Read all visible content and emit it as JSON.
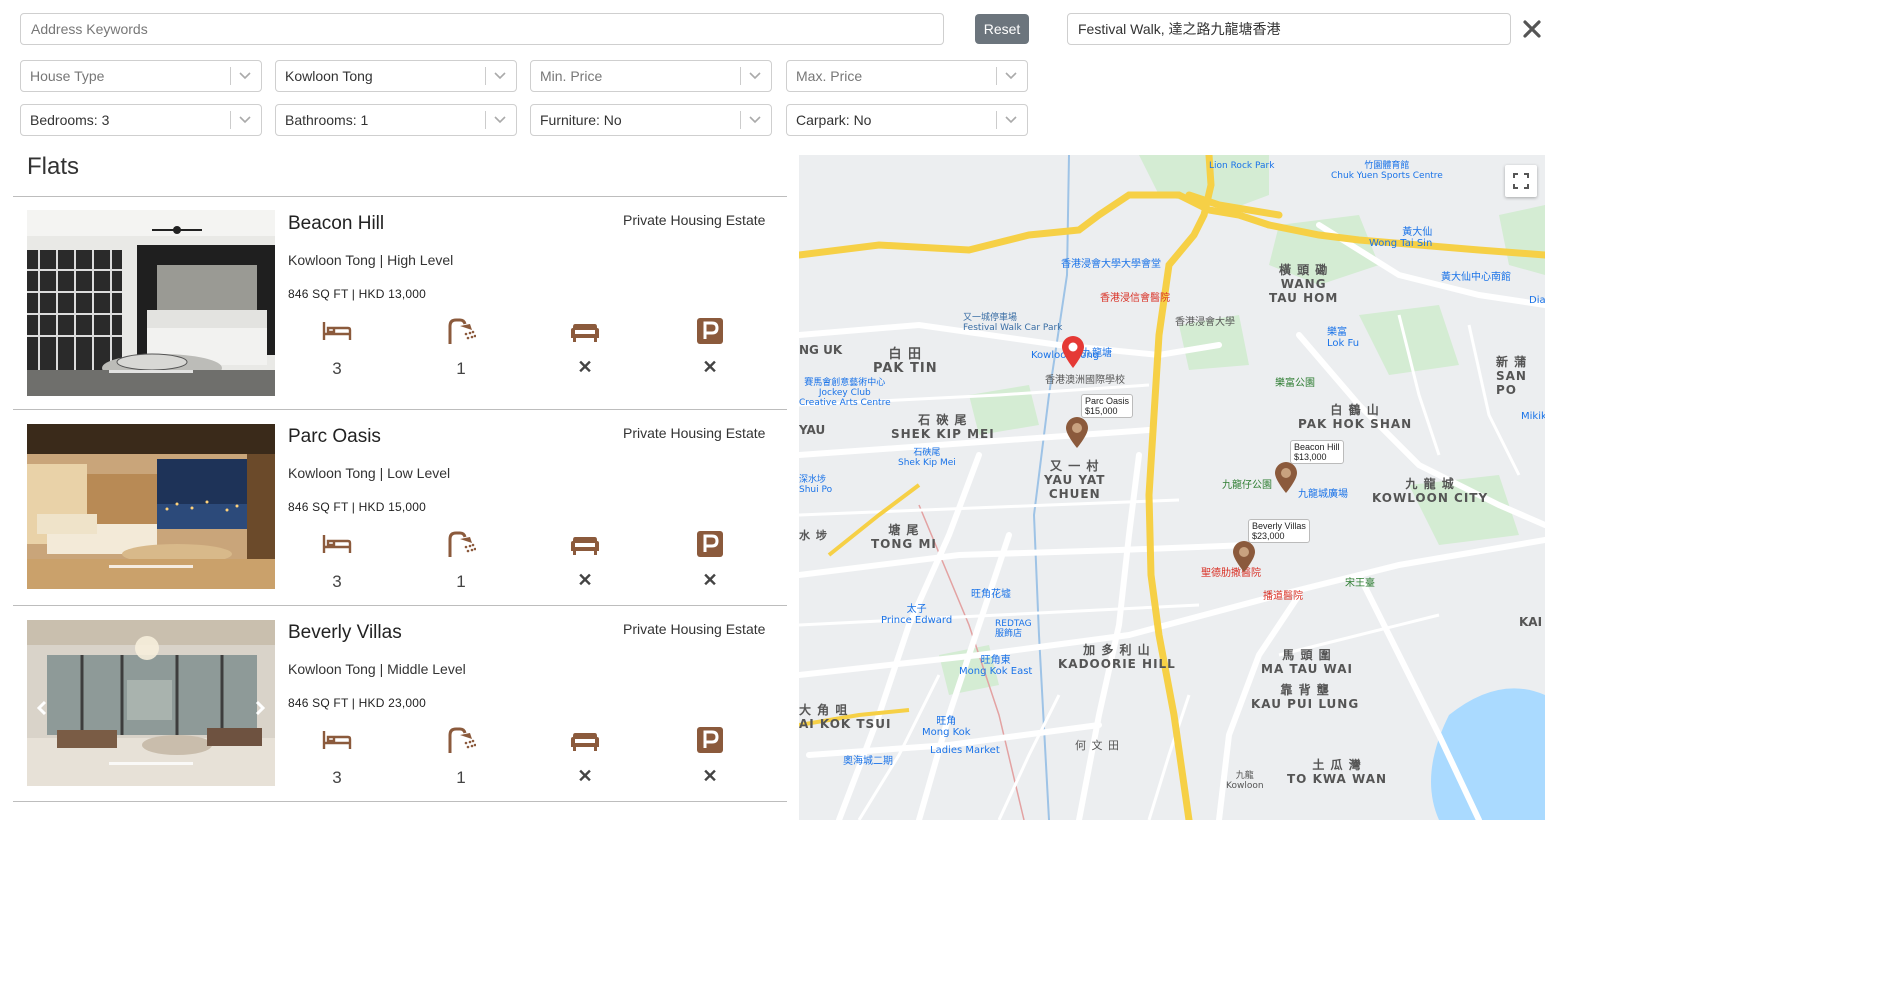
{
  "search": {
    "address_placeholder": "Address Keywords",
    "reset_label": "Reset",
    "location_value": "Festival Walk, 達之路九龍塘香港",
    "close_label": "✕"
  },
  "filters": [
    {
      "id": "house-type",
      "value": "House Type",
      "placeholder": true
    },
    {
      "id": "district",
      "value": "Kowloon Tong",
      "placeholder": false
    },
    {
      "id": "min-price",
      "value": "Min. Price",
      "placeholder": true
    },
    {
      "id": "max-price",
      "value": "Max. Price",
      "placeholder": true
    },
    {
      "id": "bedrooms",
      "value": "Bedrooms: 3",
      "placeholder": false
    },
    {
      "id": "bathrooms",
      "value": "Bathrooms: 1",
      "placeholder": false
    },
    {
      "id": "furniture",
      "value": "Furniture: No",
      "placeholder": false
    },
    {
      "id": "carpark",
      "value": "Carpark: No",
      "placeholder": false
    }
  ],
  "section_title": "Flats",
  "flats": [
    {
      "name": "Beacon Hill",
      "type": "Private Housing Estate",
      "location": "Kowloon Tong | High Level",
      "size_price": "846 SQ FT | HKD 13,000",
      "bedrooms": "3",
      "bathrooms": "1",
      "furniture": "✕",
      "carpark": "✕"
    },
    {
      "name": "Parc Oasis",
      "type": "Private Housing Estate",
      "location": "Kowloon Tong | Low Level",
      "size_price": "846 SQ FT | HKD 15,000",
      "bedrooms": "3",
      "bathrooms": "1",
      "furniture": "✕",
      "carpark": "✕"
    },
    {
      "name": "Beverly Villas",
      "type": "Private Housing Estate",
      "location": "Kowloon Tong | Middle Level",
      "size_price": "846 SQ FT | HKD 23,000",
      "bedrooms": "3",
      "bathrooms": "1",
      "furniture": "✕",
      "carpark": "✕"
    }
  ],
  "map": {
    "accent_brown": "#8b5a3c",
    "pin_red": "#e53935",
    "markers": [
      {
        "name": "Parc Oasis",
        "price": "$15,000"
      },
      {
        "name": "Beacon Hill",
        "price": "$13,000"
      },
      {
        "name": "Beverly Villas",
        "price": "$23,000"
      }
    ],
    "labels": {
      "pak_tin": "PAK TIN",
      "pak_tin_zh": "白 田",
      "shek_kip_mei": "SHEK KIP MEI",
      "shek_kip_mei_zh": "石 硤 尾",
      "yau_yat_chuen": "YAU YAT\nCHUEN",
      "yau_yat_chuen_zh": "又 一 村",
      "tong_mi": "TONG MI",
      "tong_mi_zh": "塘 尾",
      "kadoorie_hill": "KADOORIE HILL",
      "kadoorie_hill_zh": "加 多 利 山",
      "ma_tau_wai": "MA TAU WAI",
      "ma_tau_wai_zh": "馬 頭 圍",
      "kau_pui_lung": "KAU PUI LUNG",
      "kau_pui_lung_zh": "靠 背 壟",
      "to_kwa_wan": "TO KWA WAN",
      "to_kwa_wan_zh": "土 瓜 灣",
      "kowloon_city": "KOWLOON CITY",
      "kowloon_city_zh": "九 龍 城",
      "pak_hok_shan": "PAK HOK SHAN",
      "pak_hok_shan_zh": "白 鶴 山",
      "wang_tau_hom": "WANG\nTAU HOM",
      "wang_tau_hom_zh": "橫 頭 磡",
      "san_po": "SAN PO",
      "san_po_zh": "新 蒲",
      "tai_kok_tsui": "AI KOK TSUI",
      "tai_kok_tsui_zh": "大 角 咀",
      "ho_man_tin_zh": "何 文 田",
      "sham_shui_po": "深水埗\nShui Po",
      "kowloon_tong_station": "Kowloon Tong",
      "kowloon_tong_zh": "九龍塘",
      "festival_walk": "又一城停車場\nFestival Walk Car Park",
      "hkbu": "香港浸會大學大學會堂",
      "hkbu_hospital": "香港浸信會醫院",
      "hkbu2": "香港浸會大學",
      "jockey_club": "賽馬會創意藝術中心\nJockey Club\nCreative Arts Centre",
      "shek_kip_mei_station": "石硤尾\nShek Kip Mei",
      "prince_edward": "太子\nPrince Edward",
      "mong_kok_east": "旺角東\nMong Kok East",
      "mong_kok": "旺角\nMong Kok",
      "ladies_market": "Ladies Market",
      "redtag": "REDTAG\n服飾店",
      "olympian": "奧海城二期",
      "flower_market": "旺角花墟",
      "st_teresa": "聖德肋撒醫院",
      "bo_shan": "播道醫院",
      "chuk_yuen": "竹園體育館\nChuk Yuen Sports Centre",
      "lion_rock": "Lion Rock Park",
      "wong_tai_sin": "黃大仙\nWong Tai Sin",
      "wts_centre": "黃大仙中心南館",
      "lok_fu": "樂富\nLok Fu",
      "lok_fu_park": "樂富公園",
      "kln_walled": "九龍仔公園",
      "kln_city_plaza": "九龍城廣場",
      "kowloon": "九龍\nKowloon",
      "creative": "香港澳洲國際學校",
      "sung_wong": "宋王臺",
      "mikiki": "Mikiki",
      "uk": "NG UK",
      "yau": "YAU",
      "shui_pu": "水 埗",
      "kai": "KAI",
      "dia": "Dia"
    }
  }
}
